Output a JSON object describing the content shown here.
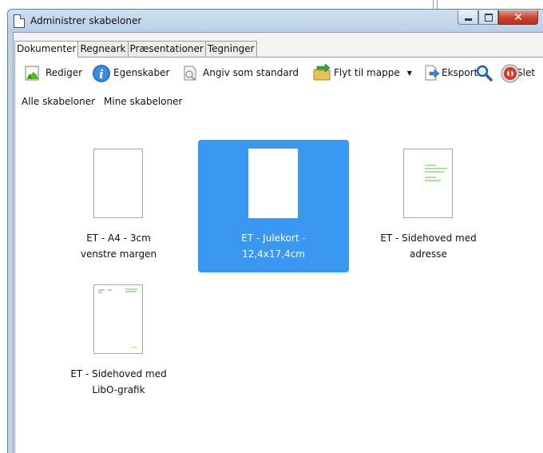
{
  "window": {
    "title": "Administrer skabeloner"
  },
  "tabs": [
    {
      "label": "Dokumenter",
      "active": true
    },
    {
      "label": "Regneark",
      "active": false
    },
    {
      "label": "Præsentationer",
      "active": false
    },
    {
      "label": "Tegninger",
      "active": false
    }
  ],
  "toolbar": {
    "edit_label": "Rediger",
    "properties_label": "Egenskaber",
    "set_default_label": "Angiv som standard",
    "move_label": "Flyt til mappe",
    "export_label": "Eksporter",
    "delete_label": "Slet"
  },
  "filters": {
    "all_label": "Alle skabeloner",
    "mine_label": "Mine skabeloner"
  },
  "templates": [
    {
      "label": "ET - A4 - 3cm\nvenstre margen",
      "selected": false
    },
    {
      "label": "ET - Julekort -\n12,4x17,4cm",
      "selected": true
    },
    {
      "label": "ET - Sidehoved med\nadresse",
      "selected": false
    },
    {
      "label": "ET - Sidehoved med\nLibO-grafik",
      "selected": false
    }
  ],
  "colors": {
    "selection": "#3a98f2",
    "window_frame": "#bcd3e9",
    "close_button": "#c8412c"
  },
  "icons": [
    "edit-icon",
    "info-icon",
    "set-default-icon",
    "move-to-folder-icon",
    "export-icon",
    "search-icon",
    "delete-icon"
  ]
}
